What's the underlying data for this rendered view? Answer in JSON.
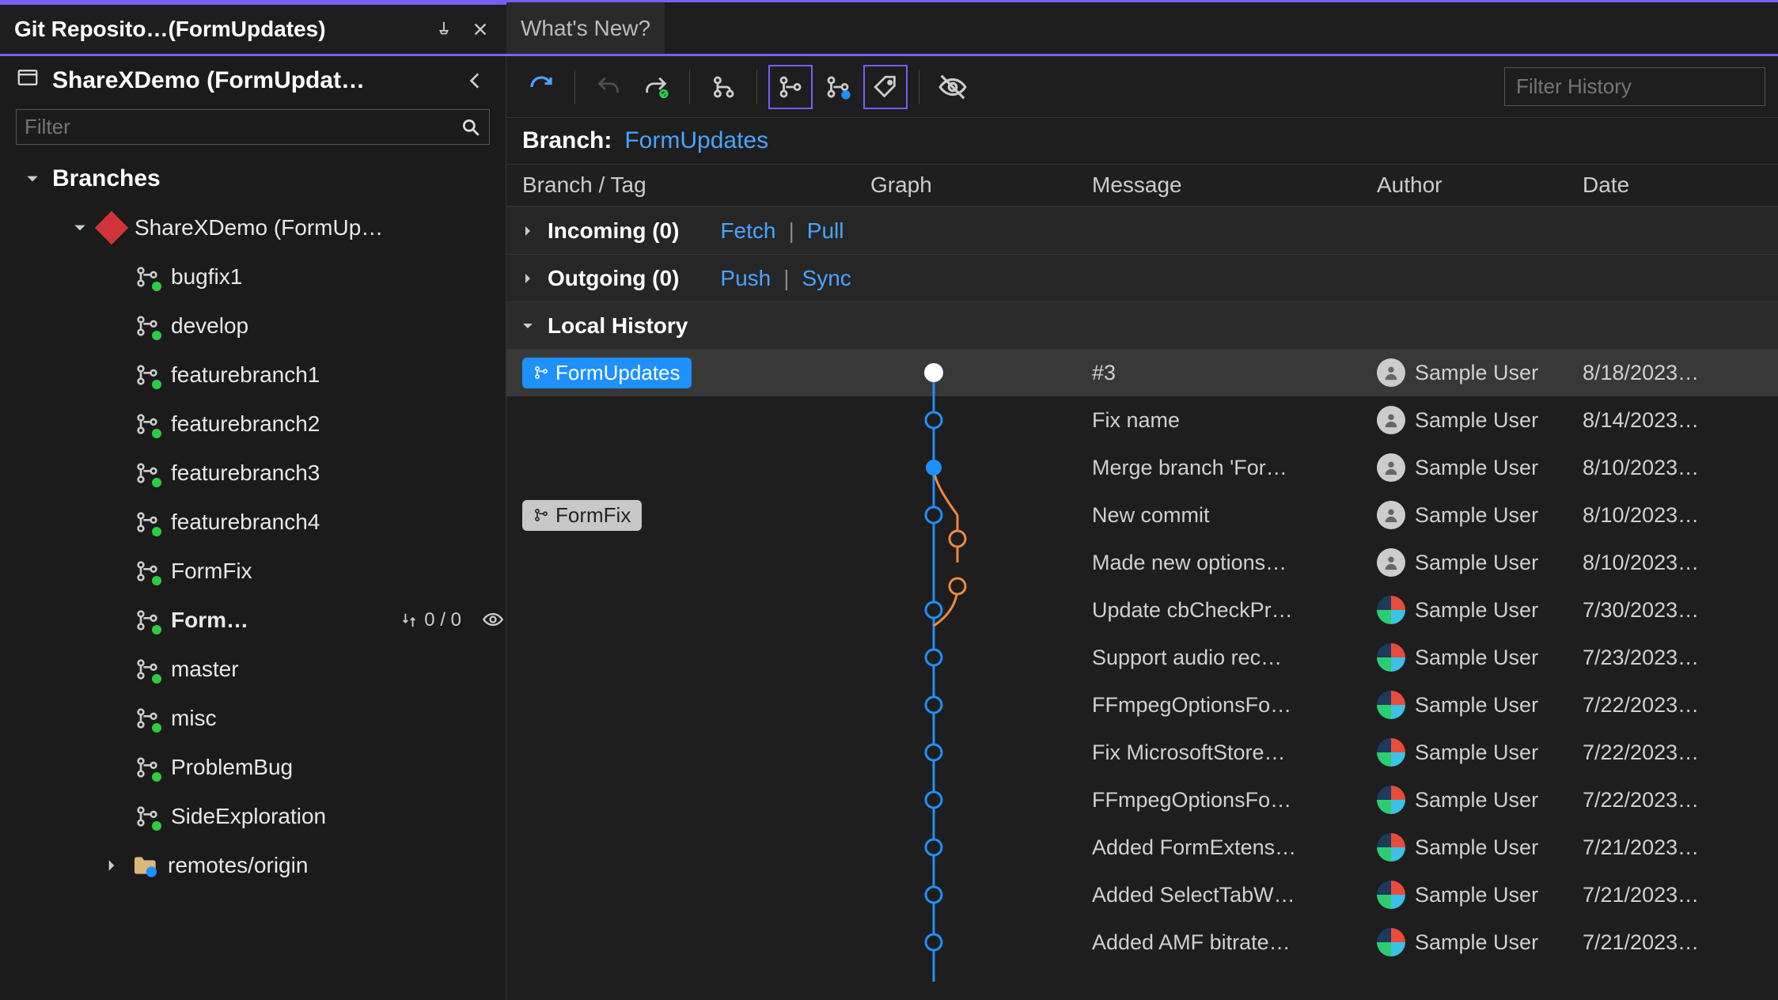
{
  "tabs": {
    "active_label": "Git Reposito…(FormUpdates)",
    "inactive_label": "What's New?"
  },
  "sidebar": {
    "title": "ShareXDemo (FormUpdat…",
    "filter_placeholder": "Filter",
    "branches_heading": "Branches",
    "repo_label": "ShareXDemo (FormUp…",
    "branches": [
      {
        "name": "bugfix1"
      },
      {
        "name": "develop"
      },
      {
        "name": "featurebranch1"
      },
      {
        "name": "featurebranch2"
      },
      {
        "name": "featurebranch3"
      },
      {
        "name": "featurebranch4"
      },
      {
        "name": "FormFix"
      },
      {
        "name": "Form…",
        "current": true,
        "sync": "0 / 0"
      },
      {
        "name": "master"
      },
      {
        "name": "misc"
      },
      {
        "name": "ProblemBug"
      },
      {
        "name": "SideExploration"
      }
    ],
    "remotes_label": "remotes/origin"
  },
  "toolbar": {
    "filter_history_placeholder": "Filter History"
  },
  "branch_header": {
    "label": "Branch:",
    "value": "FormUpdates"
  },
  "columns": {
    "c0": "Branch / Tag",
    "c1": "Graph",
    "c2": "Message",
    "c3": "Author",
    "c4": "Date"
  },
  "sections": {
    "incoming": {
      "title": "Incoming (0)",
      "a": "Fetch",
      "b": "Pull"
    },
    "outgoing": {
      "title": "Outgoing (0)",
      "a": "Push",
      "b": "Sync"
    },
    "local": {
      "title": "Local History"
    }
  },
  "history": [
    {
      "tag": "FormUpdates",
      "tag_style": "blue",
      "message": "#3",
      "author": "Sample User",
      "avatar": "user",
      "date": "8/18/2023…",
      "selected": true
    },
    {
      "message": "Fix name",
      "author": "Sample User",
      "avatar": "user",
      "date": "8/14/2023…"
    },
    {
      "message": "Merge branch 'For…",
      "author": "Sample User",
      "avatar": "user",
      "date": "8/10/2023…"
    },
    {
      "tag": "FormFix",
      "tag_style": "grey",
      "message": "New commit",
      "author": "Sample User",
      "avatar": "user",
      "date": "8/10/2023…"
    },
    {
      "message": "Made new options…",
      "author": "Sample User",
      "avatar": "user",
      "date": "8/10/2023…"
    },
    {
      "message": "Update cbCheckPr…",
      "author": "Sample User",
      "avatar": "sharex",
      "date": "7/30/2023…"
    },
    {
      "message": "Support audio rec…",
      "author": "Sample User",
      "avatar": "sharex",
      "date": "7/23/2023…"
    },
    {
      "message": "FFmpegOptionsFo…",
      "author": "Sample User",
      "avatar": "sharex",
      "date": "7/22/2023…"
    },
    {
      "message": "Fix MicrosoftStore…",
      "author": "Sample User",
      "avatar": "sharex",
      "date": "7/22/2023…"
    },
    {
      "message": "FFmpegOptionsFo…",
      "author": "Sample User",
      "avatar": "sharex",
      "date": "7/22/2023…"
    },
    {
      "message": "Added FormExtens…",
      "author": "Sample User",
      "avatar": "sharex",
      "date": "7/21/2023…"
    },
    {
      "message": "Added SelectTabW…",
      "author": "Sample User",
      "avatar": "sharex",
      "date": "7/21/2023…"
    },
    {
      "message": "Added AMF bitrate…",
      "author": "Sample User",
      "avatar": "sharex",
      "date": "7/21/2023…"
    }
  ]
}
